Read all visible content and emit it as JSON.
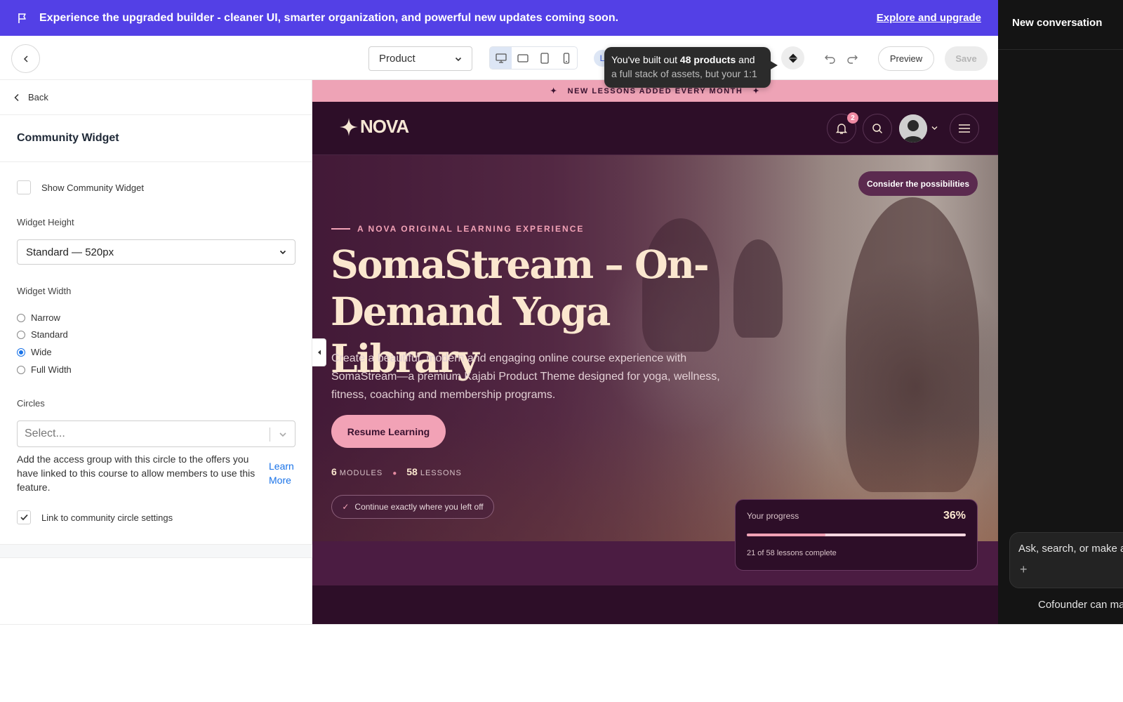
{
  "banner": {
    "message": "Experience the upgraded builder - cleaner UI, smarter organization, and powerful new updates coming soon.",
    "cta": "Explore and upgrade",
    "color": "#5340e6"
  },
  "chat": {
    "title": "New conversation",
    "input_placeholder": "Ask, search, or make a",
    "plus": "+",
    "footer": "Cofounder can ma"
  },
  "toolbar": {
    "page_select": "Product",
    "devices": [
      "desktop-icon",
      "tablet-landscape-icon",
      "tablet-portrait-icon",
      "mobile-icon"
    ],
    "active_device": 0,
    "avatar_letter": "L",
    "tooltip": {
      "pre": "You've built out ",
      "bold": "48 products",
      "post": " and",
      "line2": "a full stack of assets, but your 1:1"
    },
    "preview_label": "Preview",
    "save_label": "Save"
  },
  "settings": {
    "back_label": "Back",
    "section_title": "Community Widget",
    "show_widget_label": "Show Community Widget",
    "show_widget_checked": false,
    "height_label": "Widget Height",
    "height_value": "Standard — 520px",
    "width_label": "Widget Width",
    "width_options": [
      "Narrow",
      "Standard",
      "Wide",
      "Full Width"
    ],
    "width_selected": "Wide",
    "circles_label": "Circles",
    "circles_placeholder": "Select...",
    "help_text": "Add the access group with this circle to the offers you have linked to this course to allow members to use this feature.",
    "learn_more": "Learn More",
    "link_settings_label": "Link to community circle settings",
    "link_settings_checked": true
  },
  "site": {
    "announcement": "NEW LESSONS ADDED EVERY MONTH",
    "logo_text": "NOVA",
    "notification_count": "2",
    "consider_badge": "Consider the possibilities",
    "eyebrow": "A NOVA ORIGINAL LEARNING EXPERIENCE",
    "title": "SomaStream – On-Demand Yoga Library",
    "description": "Create a beautiful, modern and engaging online course experience with SomaStream—a premium Kajabi Product Theme designed for yoga, wellness, fitness, coaching and membership programs.",
    "resume_button": "Resume Learning",
    "modules_count": "6",
    "modules_label": "MODULES",
    "lessons_count": "58",
    "lessons_label": "LESSONS",
    "continue_text": "Continue exactly where you left off",
    "progress": {
      "label": "Your progress",
      "percent_text": "36%",
      "percent": 36,
      "count_text": "21 of 58 lessons complete"
    },
    "colors": {
      "accent_pink": "#f2a2b6",
      "dark_plum": "#2d0e28",
      "cream": "#fbe7cf"
    }
  }
}
